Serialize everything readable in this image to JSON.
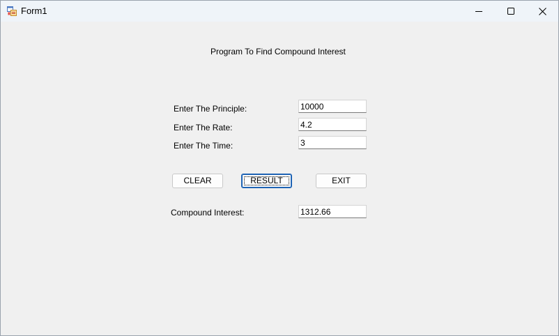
{
  "window": {
    "title": "Form1",
    "icons": {
      "app": "winforms-app-icon",
      "minimize": "minimize-icon",
      "maximize": "maximize-icon",
      "close": "close-icon"
    }
  },
  "form": {
    "heading": "Program To Find Compound Interest",
    "principle_label": "Enter The Principle:",
    "principle_value": "10000",
    "rate_label": "Enter The Rate:",
    "rate_value": "4.2",
    "time_label": "Enter The Time:",
    "time_value": "3",
    "clear_label": "CLEAR",
    "result_label": "RESULT",
    "exit_label": "EXIT",
    "ci_label": "Compound Interest:",
    "ci_value": "1312.66",
    "focused_button": "RESULT"
  },
  "colors": {
    "window_bg": "#f0f0f0",
    "titlebar_bg": "#eff4f9",
    "accent_focus": "#1e63b4"
  }
}
